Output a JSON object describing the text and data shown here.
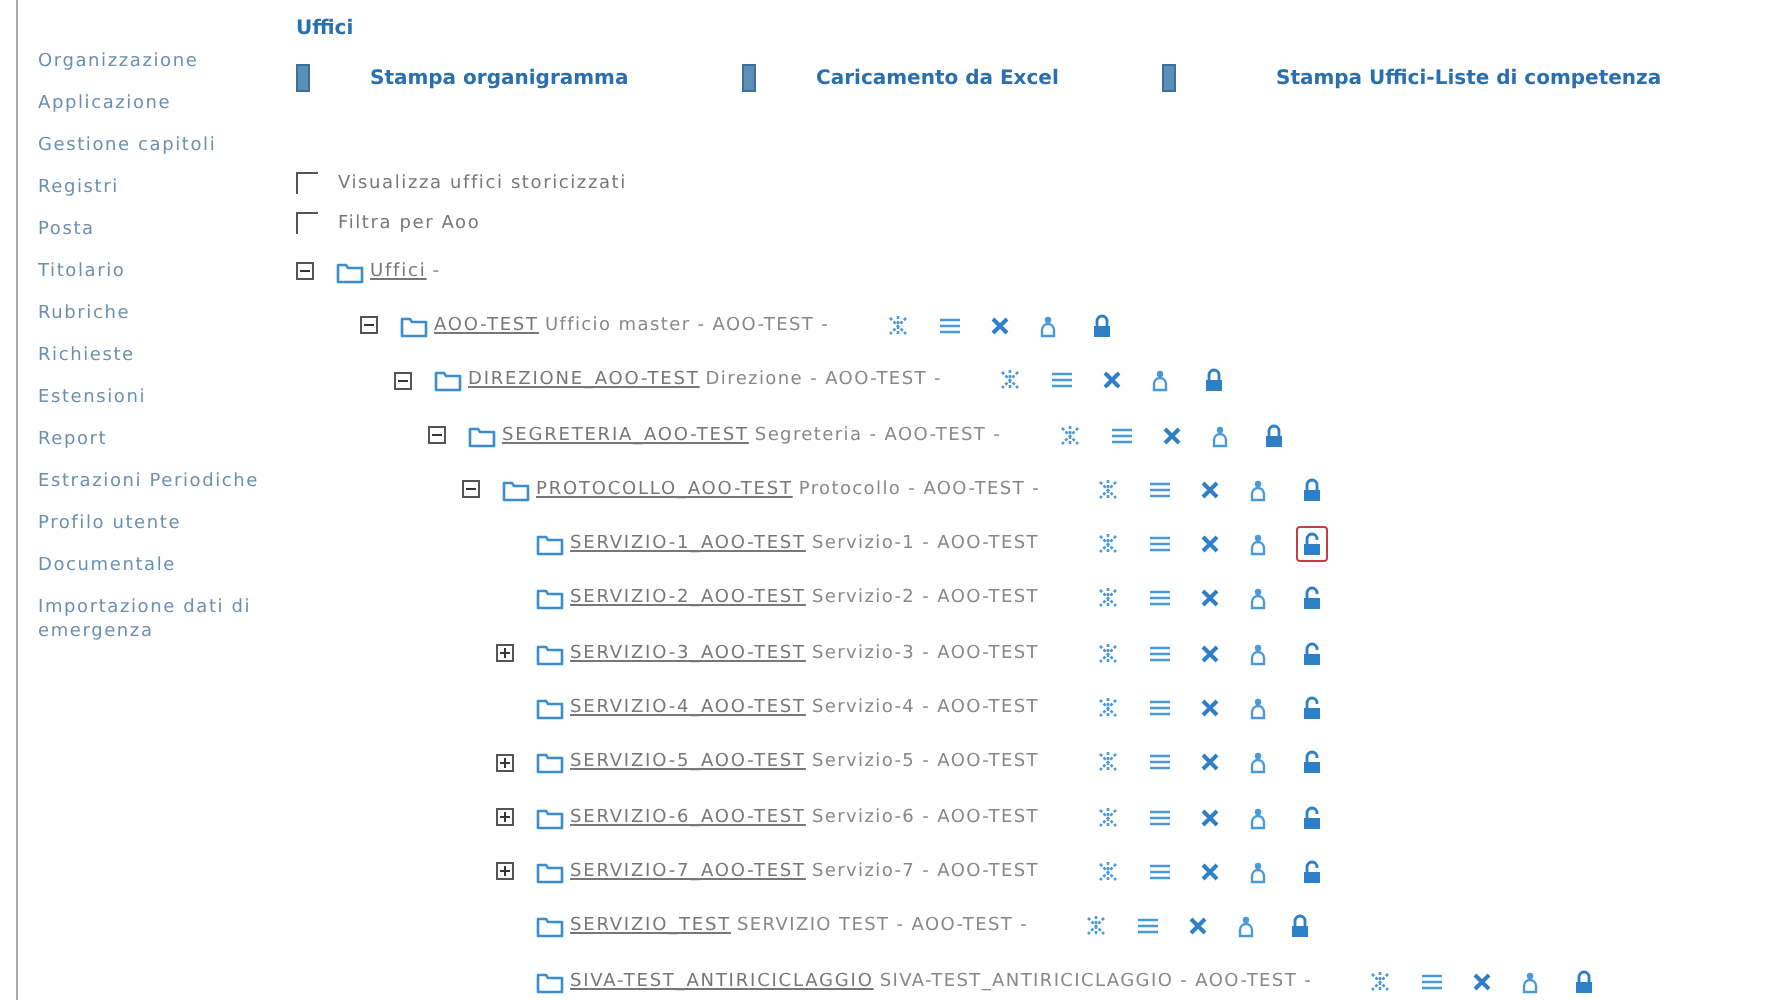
{
  "sidebar": {
    "items": [
      "Organizzazione",
      "Applicazione",
      "Gestione capitoli",
      "Registri",
      "Posta",
      "Titolario",
      "Rubriche",
      "Richieste",
      "Estensioni",
      "Report",
      "Estrazioni Periodiche",
      "Profilo utente",
      "Documentale",
      "Importazione dati di emergenza"
    ]
  },
  "title": "Uffici",
  "toolbar": [
    "Stampa organigramma",
    "Caricamento da Excel",
    "Stampa Uffici-Liste di competenza"
  ],
  "options": [
    {
      "label": "Visualizza uffici storicizzati",
      "checked": false
    },
    {
      "label": "Filtra per Aoo",
      "checked": false
    }
  ],
  "tree": {
    "code": "Uffici",
    "rest": "-",
    "expanded": true,
    "children": [
      {
        "code": "AOO-TEST",
        "rest": "Ufficio master - AOO-TEST -",
        "expanded": true,
        "locked": true,
        "selected": false,
        "children": [
          {
            "code": "DIREZIONE_AOO-TEST",
            "rest": "Direzione - AOO-TEST -",
            "expanded": true,
            "locked": true,
            "selected": false,
            "children": [
              {
                "code": "SEGRETERIA_AOO-TEST",
                "rest": "Segreteria - AOO-TEST -",
                "expanded": true,
                "locked": true,
                "selected": false,
                "children": [
                  {
                    "code": "PROTOCOLLO_AOO-TEST",
                    "rest": "Protocollo - AOO-TEST -",
                    "expanded": true,
                    "locked": true,
                    "selected": false,
                    "children": [
                      {
                        "code": "SERVIZIO-1_AOO-TEST",
                        "rest": "Servizio-1 - AOO-TEST",
                        "locked": false,
                        "selected": true
                      },
                      {
                        "code": "SERVIZIO-2_AOO-TEST",
                        "rest": "Servizio-2 - AOO-TEST",
                        "locked": false,
                        "selected": false
                      },
                      {
                        "code": "SERVIZIO-3_AOO-TEST",
                        "rest": "Servizio-3 - AOO-TEST",
                        "expanded": false,
                        "locked": false,
                        "selected": false
                      },
                      {
                        "code": "SERVIZIO-4_AOO-TEST",
                        "rest": "Servizio-4 - AOO-TEST",
                        "locked": false,
                        "selected": false
                      },
                      {
                        "code": "SERVIZIO-5_AOO-TEST",
                        "rest": "Servizio-5 - AOO-TEST",
                        "expanded": false,
                        "locked": false,
                        "selected": false
                      },
                      {
                        "code": "SERVIZIO-6_AOO-TEST",
                        "rest": "Servizio-6 - AOO-TEST",
                        "expanded": false,
                        "locked": false,
                        "selected": false
                      },
                      {
                        "code": "SERVIZIO-7_AOO-TEST",
                        "rest": "Servizio-7 - AOO-TEST",
                        "expanded": false,
                        "locked": false,
                        "selected": false
                      },
                      {
                        "code": "SERVIZIO_TEST",
                        "rest": "SERVIZIO TEST - AOO-TEST -",
                        "locked": true,
                        "selected": false
                      },
                      {
                        "code": "SIVA-TEST_ANTIRICICLAGGIO",
                        "rest": "SIVA-TEST_ANTIRICICLAGGIO - AOO-TEST -",
                        "locked": true,
                        "selected": false
                      }
                    ]
                  }
                ]
              }
            ]
          }
        ]
      }
    ]
  }
}
